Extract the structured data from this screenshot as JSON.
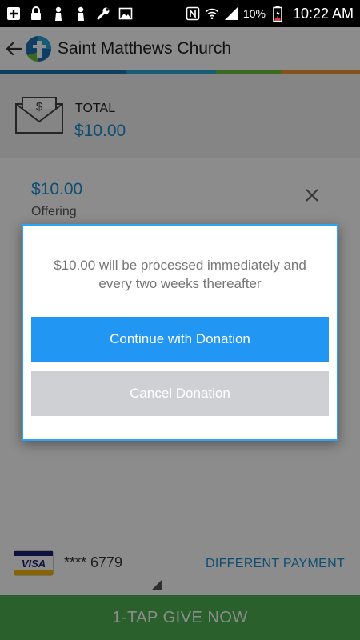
{
  "status_bar": {
    "icons_left": [
      "add-box-icon",
      "lock-icon",
      "person-icon",
      "person-icon",
      "wrench-icon",
      "image-icon"
    ],
    "icons_right": [
      "nfc-icon",
      "wifi-icon",
      "signal-icon",
      "battery-icon"
    ],
    "battery": "10%",
    "time": "10:22 AM"
  },
  "app_bar": {
    "title": "Saint Matthews Church"
  },
  "total": {
    "label": "TOTAL",
    "amount": "$10.00"
  },
  "line_item": {
    "amount": "$10.00",
    "label": "Offering"
  },
  "payment": {
    "card_brand": "VISA",
    "card_number": "**** 6779",
    "different_payment": "DIFFERENT PAYMENT"
  },
  "give_button": "1-TAP GIVE NOW",
  "dialog": {
    "message": "$10.00 will be processed immediately and every two weeks thereafter",
    "continue_label": "Continue with Donation",
    "cancel_label": "Cancel Donation"
  },
  "colors": {
    "accent_blue": "#1a8fd0",
    "button_blue": "#2196f3",
    "give_green": "#4caf50",
    "cancel_gray": "#cfd0d4"
  }
}
